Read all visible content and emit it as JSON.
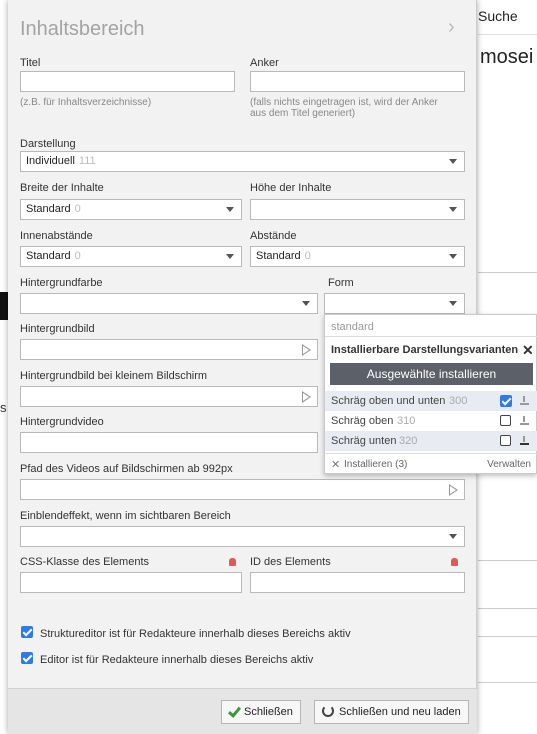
{
  "background": {
    "search_label": "Suche",
    "heading_fragment": "mosei",
    "side_letter": "s"
  },
  "panel": {
    "title": "Inhaltsbereich",
    "titel_label": "Titel",
    "titel_hint": "(z.B. für Inhaltsverzeichnisse)",
    "anker_label": "Anker",
    "anker_hint_1": "(falls nichts eingetragen ist, wird der Anker",
    "anker_hint_2": "aus dem Titel generiert)",
    "darstellung_label": "Darstellung",
    "darstellung_value": "Individuell",
    "darstellung_count": "111",
    "breite_label": "Breite der Inhalte",
    "breite_value": "Standard",
    "breite_count": "0",
    "hoehe_label": "Höhe der Inhalte",
    "innen_label": "Innenabstände",
    "innen_value": "Standard",
    "innen_count": "0",
    "abstaende_label": "Abstände",
    "abstaende_value": "Standard",
    "abstaende_count": "0",
    "hgfarbe_label": "Hintergrundfarbe",
    "form_label": "Form",
    "hgbild_label": "Hintergrundbild",
    "hgbild_klein_label": "Hintergrundbild bei kleinem Bildschirm",
    "hgvideo_label": "Hintergrundvideo",
    "videopfad_label": "Pfad des Videos auf Bildschirmen ab 992px",
    "einblend_label": "Einblendeffekt, wenn im sichtbaren Bereich",
    "css_label": "CSS-Klasse des Elements",
    "id_label": "ID des Elements",
    "check1_label": "Struktureditor ist für Redakteure innerhalb dieses Bereichs aktiv",
    "check2_label": "Editor ist für Redakteure innerhalb dieses Bereichs aktiv",
    "close_label": "Schließen",
    "close_reload_label": "Schließen und neu laden"
  },
  "dropdown": {
    "current": "standard",
    "header": "Installierbare Darstellungsvarianten",
    "install_selected": "Ausgewählte installieren",
    "items": [
      {
        "label": "Schräg oben und unten",
        "count": "300",
        "checked": true
      },
      {
        "label": "Schräg oben",
        "count": "310",
        "checked": false
      },
      {
        "label": "Schräg unten",
        "count": "320",
        "checked": false
      }
    ],
    "install_link": "Installieren (3)",
    "manage_link": "Verwalten"
  }
}
